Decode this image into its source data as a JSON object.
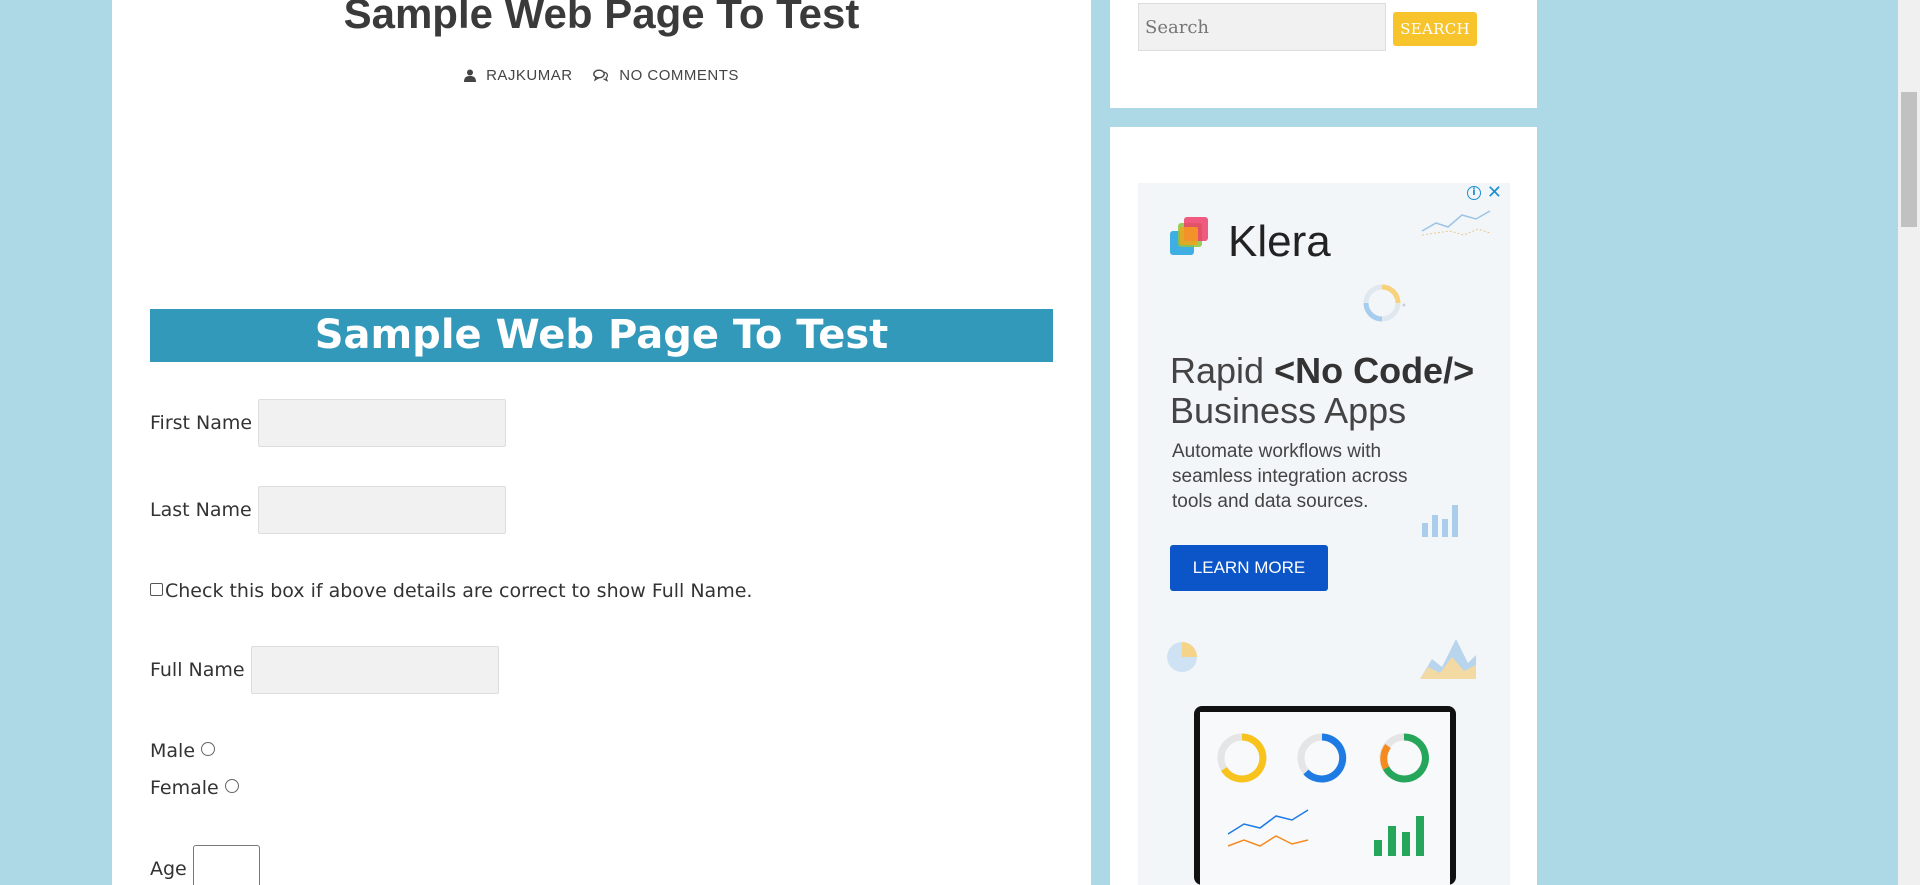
{
  "post": {
    "title": "Sample Web Page To Test",
    "author": "RAJKUMAR",
    "comments": "NO COMMENTS"
  },
  "form": {
    "banner": "Sample Web Page To Test",
    "first_name_label": "First Name",
    "last_name_label": "Last Name",
    "checkbox_label": "Check this box if above details are correct to show Full Name.",
    "full_name_label": "Full Name",
    "male_label": "Male",
    "female_label": "Female",
    "age_label": "Age"
  },
  "sidebar": {
    "search": {
      "placeholder": "Search",
      "button_label": "SEARCH"
    },
    "ad": {
      "brand": "Klera",
      "headline_part1": "Rapid ",
      "headline_bold": "<No Code/>",
      "headline_part2": "Business Apps",
      "body": "Automate workflows with seamless integration across tools and data sources.",
      "cta": "LEARN MORE",
      "info_icon": "i",
      "close_icon": "✕"
    }
  },
  "colors": {
    "page_background": "#add8e6",
    "banner": "#3399bb",
    "search_button": "#f7c42b",
    "ad_cta": "#0b55c9"
  }
}
